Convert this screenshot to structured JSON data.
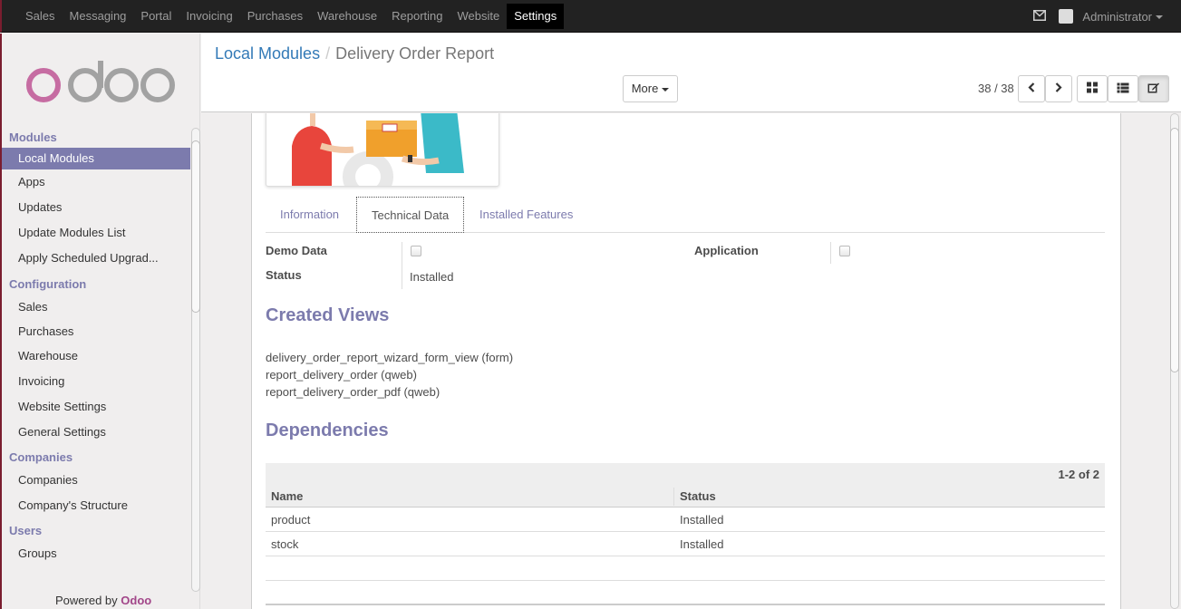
{
  "topbar": {
    "menu": [
      "Sales",
      "Messaging",
      "Portal",
      "Invoicing",
      "Purchases",
      "Warehouse",
      "Reporting",
      "Website",
      "Settings"
    ],
    "active": "Settings",
    "user": "Administrator",
    "mail_icon": "envelope-icon",
    "avatar_icon": "avatar-icon"
  },
  "sidebar": {
    "logo_text": "odoo",
    "sections": [
      {
        "title": "Modules",
        "items": [
          "Local Modules",
          "Apps",
          "Updates",
          "Update Modules List",
          "Apply Scheduled Upgrad..."
        ]
      },
      {
        "title": "Configuration",
        "items": [
          "Sales",
          "Purchases",
          "Warehouse",
          "Invoicing",
          "Website Settings",
          "General Settings"
        ]
      },
      {
        "title": "Companies",
        "items": [
          "Companies",
          "Company's Structure"
        ]
      },
      {
        "title": "Users",
        "items": [
          "Groups"
        ]
      }
    ],
    "active_item": "Local Modules",
    "powered_prefix": "Powered by",
    "powered_brand": "Odoo"
  },
  "control_panel": {
    "breadcrumb_parent": "Local Modules",
    "breadcrumb_separator": "/",
    "breadcrumb_current": "Delivery Order Report",
    "more_label": "More",
    "pager": "38 / 38",
    "icons": [
      "chevron-left-icon",
      "chevron-right-icon",
      "kanban-view-icon",
      "list-view-icon",
      "form-view-icon"
    ]
  },
  "form": {
    "tabs": [
      "Information",
      "Technical Data",
      "Installed Features"
    ],
    "active_tab": "Technical Data",
    "fields": {
      "demo_data_label": "Demo Data",
      "status_label": "Status",
      "status_value": "Installed",
      "application_label": "Application"
    },
    "created_views_title": "Created Views",
    "created_views": [
      "delivery_order_report_wizard_form_view (form)",
      "report_delivery_order (qweb)",
      "report_delivery_order_pdf (qweb)"
    ],
    "dependencies_title": "Dependencies",
    "dependencies": {
      "count": "1-2 of 2",
      "columns": [
        "Name",
        "Status"
      ],
      "rows": [
        [
          "product",
          "Installed"
        ],
        [
          "stock",
          "Installed"
        ]
      ]
    }
  },
  "colors": {
    "brand_purple": "#7c7bad",
    "link_blue": "#337ab7",
    "topbar_bg": "#222222"
  }
}
